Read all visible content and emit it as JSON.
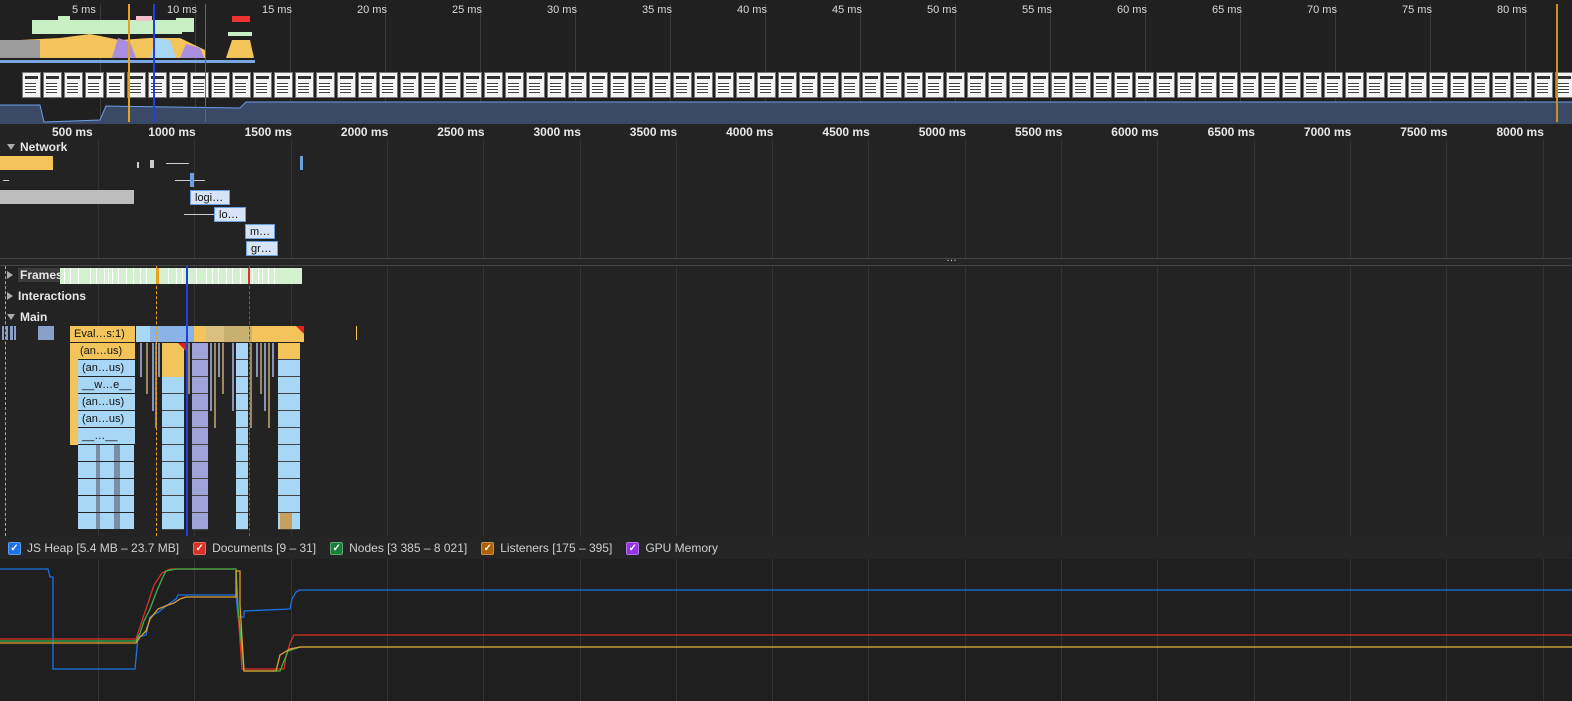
{
  "overview": {
    "ticks": [
      "5 ms",
      "10 ms",
      "15 ms",
      "20 ms",
      "25 ms",
      "30 ms",
      "35 ms",
      "40 ms",
      "45 ms",
      "50 ms",
      "55 ms",
      "60 ms",
      "65 ms",
      "70 ms",
      "75 ms",
      "80 ms"
    ]
  },
  "ruler": {
    "ticks": [
      "500 ms",
      "1000 ms",
      "1500 ms",
      "2000 ms",
      "2500 ms",
      "3000 ms",
      "3500 ms",
      "4000 ms",
      "4500 ms",
      "5000 ms",
      "5500 ms",
      "6000 ms",
      "6500 ms",
      "7000 ms",
      "7500 ms",
      "8000 ms"
    ]
  },
  "tracks": {
    "network": "Network",
    "frames": "Frames",
    "interactions": "Interactions",
    "main": "Main"
  },
  "network_labels": [
    "logi…",
    "lo…",
    "m…",
    "gr…"
  ],
  "resizer": "…",
  "flame_labels": [
    "Eval…s:1)",
    "(an…us)",
    "(an…us)",
    "__w…e__",
    "(an…us)",
    "(an…us)",
    "__…__"
  ],
  "legend": [
    {
      "label": "JS Heap [5.4 MB – 23.7 MB]",
      "color": "#1a73e8",
      "checked": true
    },
    {
      "label": "Documents [9 – 31]",
      "color": "#d93025",
      "checked": true
    },
    {
      "label": "Nodes [3 385 – 8 021]",
      "color": "#188038",
      "checked": true
    },
    {
      "label": "Listeners [175 – 395]",
      "color": "#b06000",
      "checked": true
    },
    {
      "label": "GPU Memory",
      "color": "#9334e6",
      "checked": true
    }
  ],
  "colors": {
    "scripting": "#f2c45a",
    "rendering": "#a98ee0",
    "painting": "#8fd28f",
    "system": "#a7d7f5",
    "idle_frame": "#d3f0cf",
    "js_heap": "#1a73e8",
    "documents": "#d93025",
    "nodes": "#3bb34a",
    "listeners": "#e0a030"
  }
}
